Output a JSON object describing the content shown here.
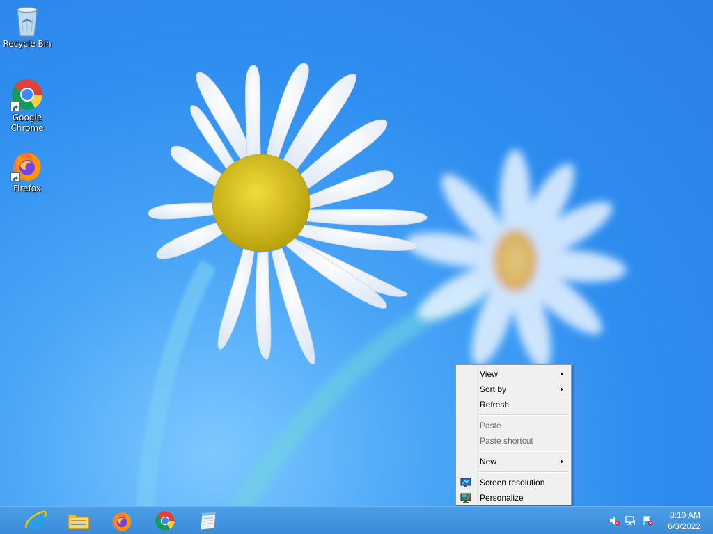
{
  "desktop": {
    "icons": [
      {
        "label": "Recycle Bin"
      },
      {
        "label": "Google\nChrome"
      },
      {
        "label": "Firefox"
      }
    ]
  },
  "context_menu": {
    "view": "View",
    "sort_by": "Sort by",
    "refresh": "Refresh",
    "paste": "Paste",
    "paste_shortcut": "Paste shortcut",
    "new": "New",
    "screen_resolution": "Screen resolution",
    "personalize": "Personalize"
  },
  "taskbar": {
    "pinned": [
      "internet-explorer-icon",
      "file-explorer-icon",
      "firefox-icon",
      "chrome-icon",
      "notepad-icon"
    ],
    "tray": [
      "volume-muted-icon",
      "network-icon",
      "action-center-icon"
    ],
    "clock_time": "8:10 AM",
    "clock_date": "6/3/2022"
  },
  "colors": {
    "taskbar": "#3a8cda",
    "menu_background": "#f0f0f0",
    "wallpaper_blue": "#2f8ef0"
  }
}
